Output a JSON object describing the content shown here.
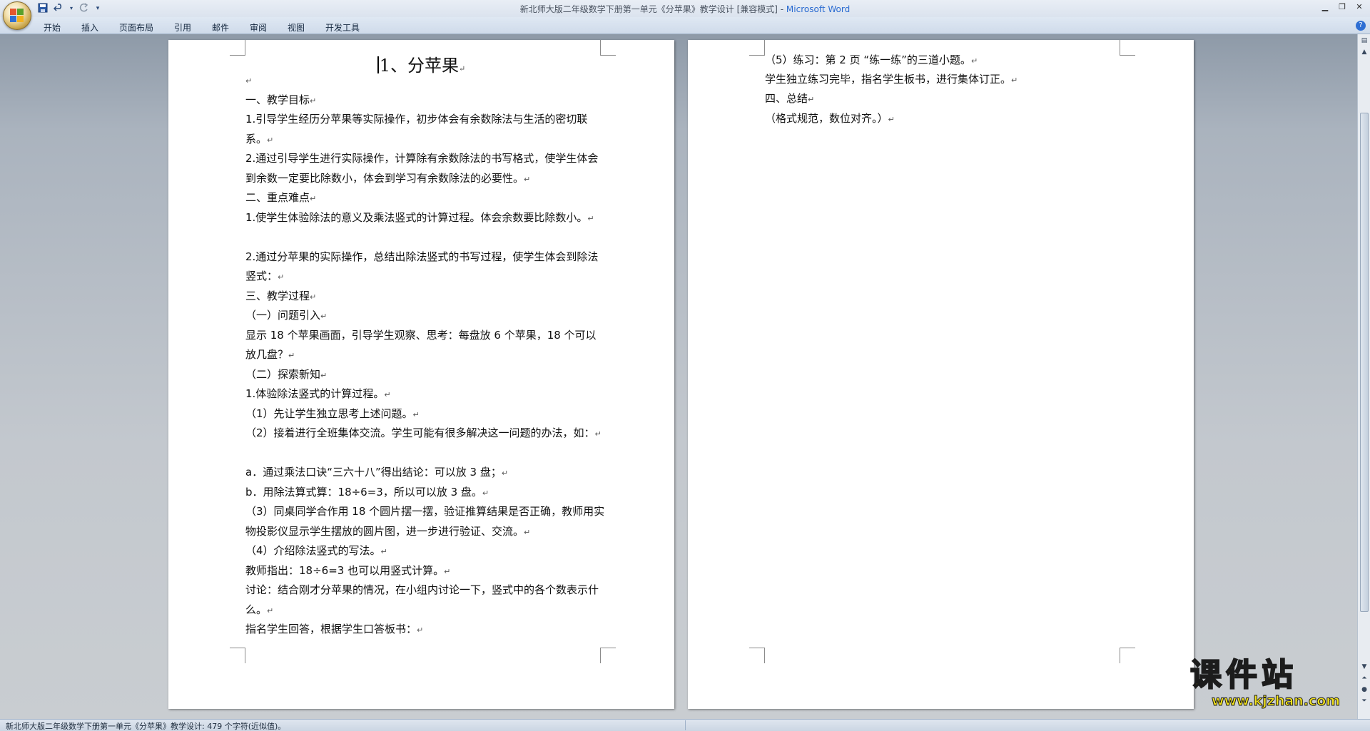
{
  "window": {
    "title": "新北师大版二年级数学下册第一单元《分苹果》教学设计 [兼容模式] - ",
    "app_name": "Microsoft Word"
  },
  "qat": {
    "save_icon": "save-icon",
    "undo_icon": "undo-icon",
    "redo_icon": "redo-icon",
    "customize_icon": "customize-icon"
  },
  "ribbon_tabs": [
    "开始",
    "插入",
    "页面布局",
    "引用",
    "邮件",
    "审阅",
    "视图",
    "开发工具"
  ],
  "document": {
    "page1": {
      "title": "1、分苹果",
      "paragraphs": [
        "",
        "一、教学目标",
        "1.引导学生经历分苹果等实际操作，初步体会有余数除法与生活的密切联系。",
        "2.通过引导学生进行实际操作，计算除有余数除法的书写格式，使学生体会到余数一定要比除数小，体会到学习有余数除法的必要性。",
        "二、重点难点",
        "1.使学生体验除法的意义及乘法竖式的计算过程。体会余数要比除数小。",
        "2.通过分苹果的实际操作，总结出除法竖式的书写过程，使学生体会到除法竖式：",
        "三、教学过程",
        "（一）问题引入",
        "显示 18 个苹果画面，引导学生观察、思考：每盘放 6 个苹果，18 个可以放几盘？",
        "（二）探索新知",
        "1.体验除法竖式的计算过程。",
        "（1）先让学生独立思考上述问题。",
        "（2）接着进行全班集体交流。学生可能有很多解决这一问题的办法，如：",
        "a．通过乘法口诀“三六十八”得出结论：可以放 3 盘；",
        "b．用除法算式算：18÷6=3，所以可以放 3 盘。",
        "（3）同桌同学合作用 18 个圆片摆一摆，验证推算结果是否正确，教师用实物投影仪显示学生摆放的圆片图，进一步进行验证、交流。",
        "（4）介绍除法竖式的写法。",
        "教师指出：18÷6=3 也可以用竖式计算。",
        "讨论：结合刚才分苹果的情况，在小组内讨论一下，竖式中的各个数表示什么。",
        "指名学生回答，根据学生口答板书："
      ]
    },
    "page2": {
      "paragraphs": [
        "（5）练习：第 2 页 “练一练”的三道小题。",
        "学生独立练习完毕，指名学生板书，进行集体订正。",
        "四、总结",
        "（格式规范，数位对齐。）"
      ]
    },
    "paragraph_mark": "↵"
  },
  "statusbar": {
    "text": "新北师大版二年级数学下册第一单元《分苹果》教学设计: 479 个字符(近似值)。"
  },
  "watermark": {
    "text": "课件站",
    "url": "www.kjzhan.com"
  },
  "colors": {
    "app_name": "#2a6bd1",
    "watermark_fill": "#f2e21c",
    "watermark_stroke": "#1c1c1c",
    "help_icon": "#2f6fd3"
  }
}
